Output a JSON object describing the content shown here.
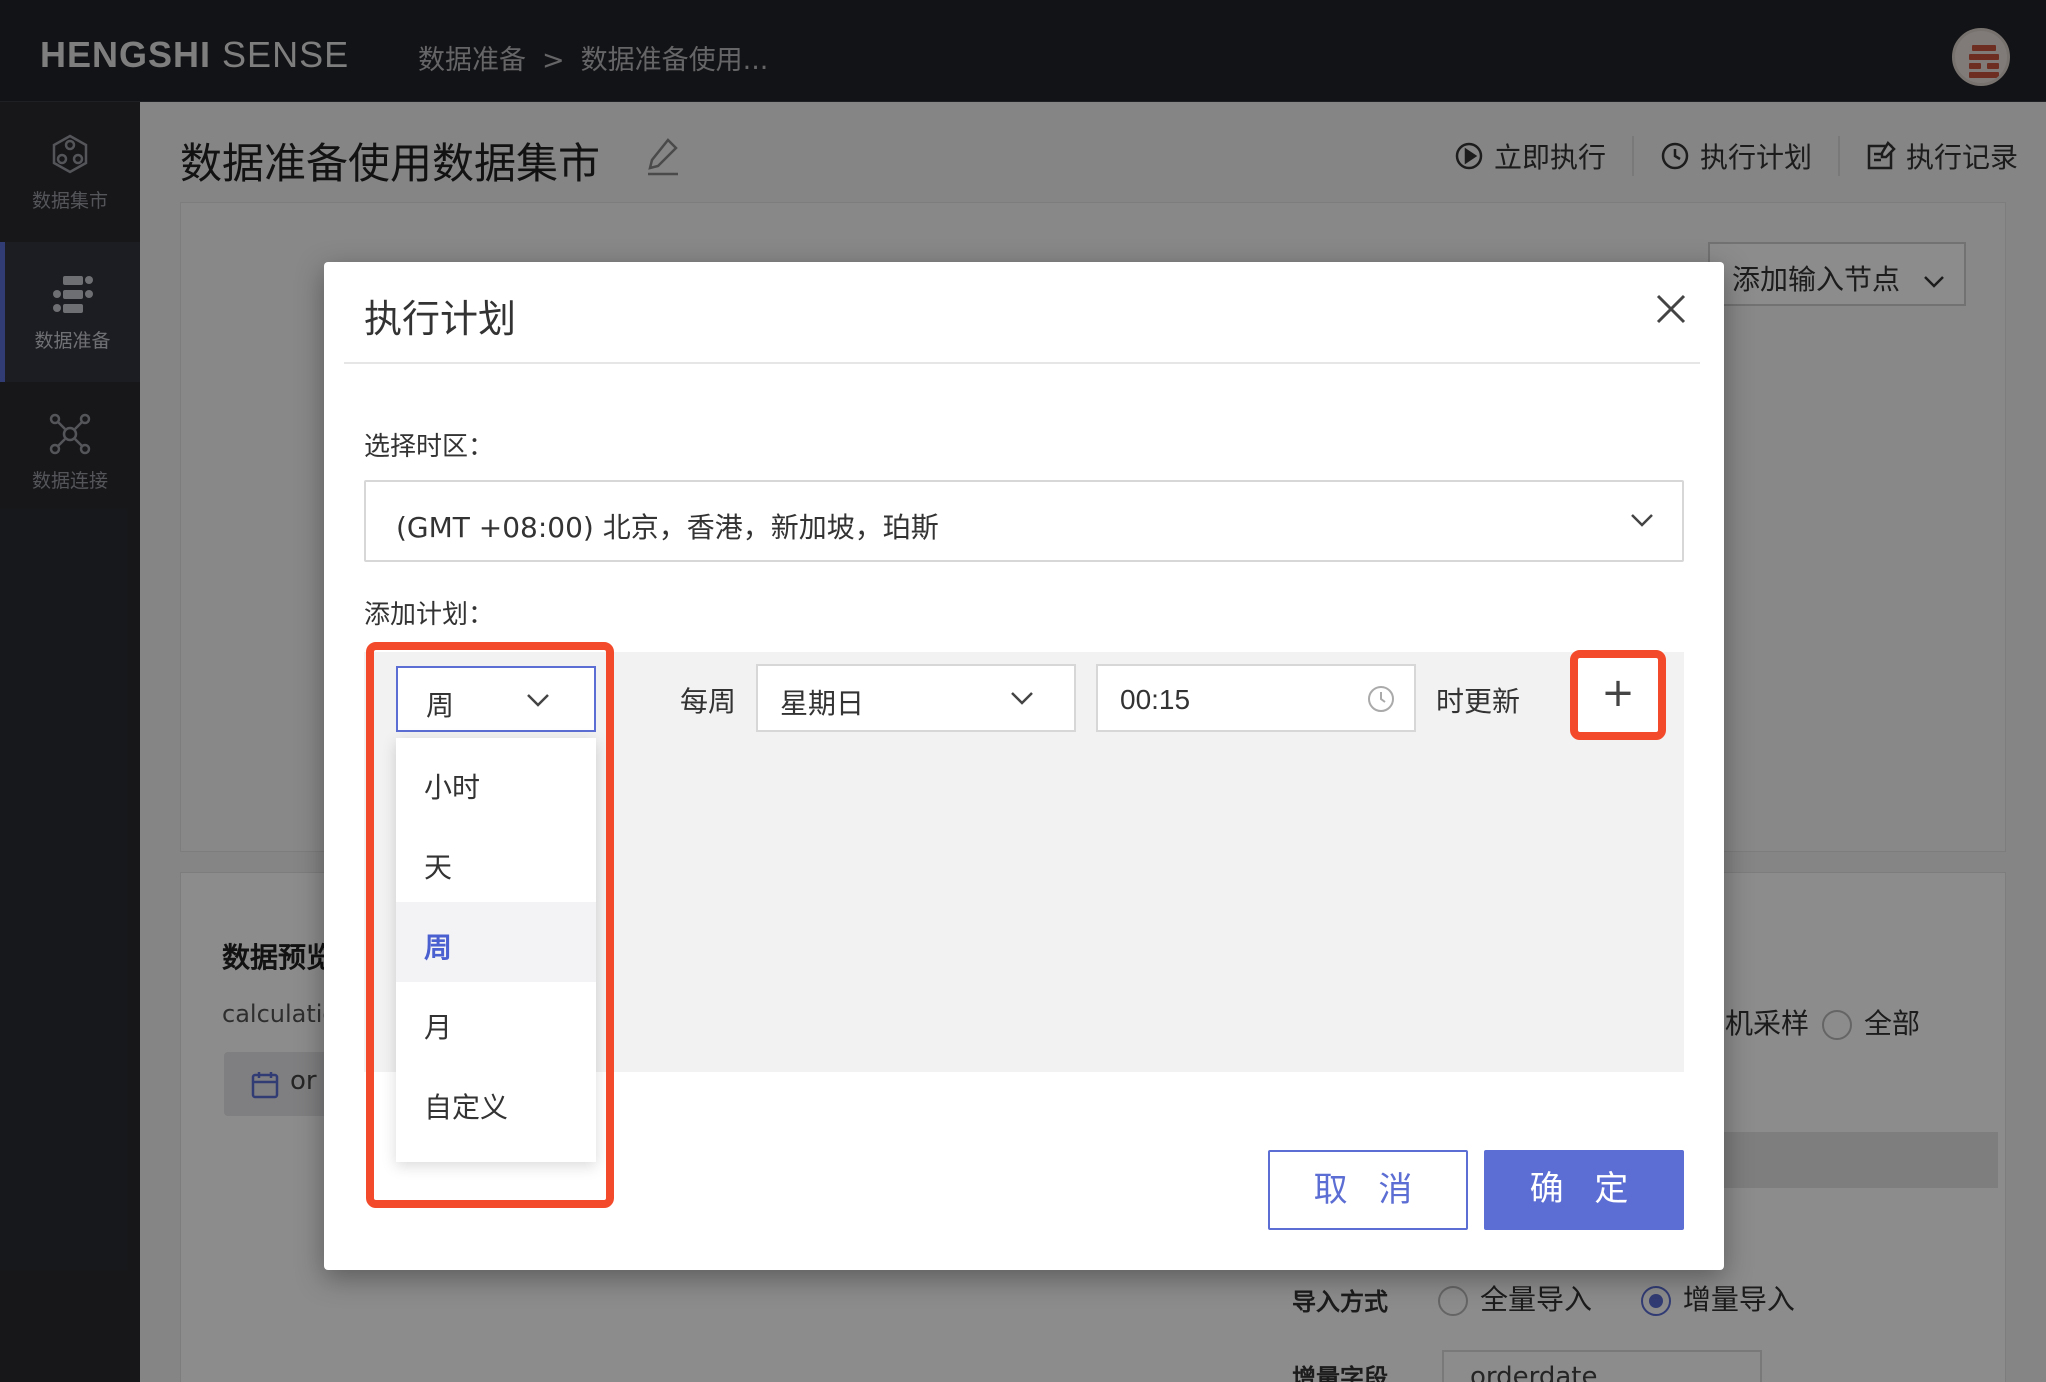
{
  "topbar": {
    "brand_bold": "HENGSHI",
    "brand_light": "SENSE",
    "breadcrumb": [
      "数据准备",
      "数据准备使用..."
    ],
    "breadcrumb_sep": ">"
  },
  "sidebar": {
    "items": [
      {
        "label": "数据集市",
        "icon": "data-mart-icon",
        "active": false
      },
      {
        "label": "数据准备",
        "icon": "data-prep-icon",
        "active": true
      },
      {
        "label": "数据连接",
        "icon": "data-connect-icon",
        "active": false
      }
    ]
  },
  "main": {
    "title": "数据准备使用数据集市",
    "actions": {
      "run_now": "立即执行",
      "schedule": "执行计划",
      "history": "执行记录"
    },
    "add_input_node": "添加输入节点",
    "preview_title": "数据预览",
    "preview_sub": "calculatio",
    "field_chip": "or",
    "sampling": "机采样",
    "sampling_all": "全部",
    "import_mode_label": "导入方式",
    "import_full": "全量导入",
    "import_incremental": "增量导入",
    "incremental_field_label": "增量字段",
    "incremental_field_value": "orderdate"
  },
  "modal": {
    "title": "执行计划",
    "timezone_label": "选择时区：",
    "timezone_value": "(GMT +08:00) 北京，香港，新加坡，珀斯",
    "plan_label": "添加计划：",
    "period_value": "周",
    "period_options": [
      "小时",
      "天",
      "周",
      "月",
      "自定义"
    ],
    "period_selected_index": 2,
    "weekly_label": "每周",
    "day_value": "星期日",
    "time_value": "00:15",
    "update_label": "时更新",
    "add_symbol": "+",
    "cancel": "取 消",
    "confirm": "确 定"
  },
  "colors": {
    "accent": "#5c6ed3",
    "highlight": "#f24a2a",
    "topbar_bg": "#222328",
    "sidebar_bg": "#2a2b31"
  }
}
